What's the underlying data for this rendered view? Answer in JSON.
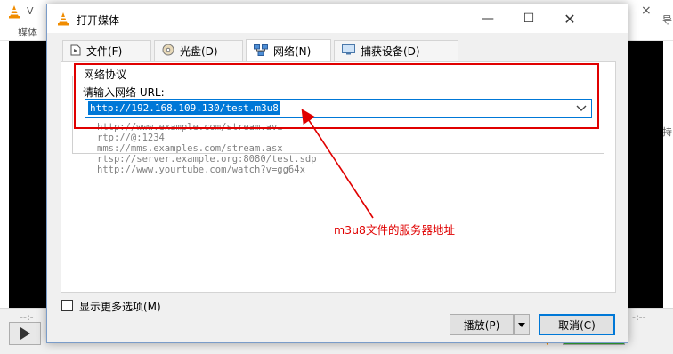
{
  "background": {
    "title_fragment": "V",
    "menu_fragment": "媒体",
    "close_glyph": "×",
    "right_fragments": [
      "导",
      "持"
    ],
    "time_left": "--:-",
    "time_right": "-:--"
  },
  "dialog": {
    "title": "打开媒体",
    "minimize_glyph": "—",
    "maximize_glyph": "☐",
    "close_glyph": "✕",
    "tabs": [
      {
        "label": "文件(F)",
        "icon": "file-icon"
      },
      {
        "label": "光盘(D)",
        "icon": "disc-icon"
      },
      {
        "label": "网络(N)",
        "icon": "network-icon"
      },
      {
        "label": "捕获设备(D)",
        "icon": "capture-device-icon"
      }
    ],
    "active_tab": 2,
    "group_title": "网络协议",
    "url_prompt": "请输入网络 URL:",
    "url_value": "http://192.168.109.130/test.m3u8",
    "examples": [
      "http://www.example.com/stream.avi",
      "rtp://@:1234",
      "mms://mms.examples.com/stream.asx",
      "rtsp://server.example.org:8080/test.sdp",
      "http://www.yourtube.com/watch?v=gg64x"
    ],
    "more_options_label": "显示更多选项(M)",
    "play_label": "播放(P)",
    "cancel_label": "取消(C)"
  },
  "annotation": {
    "text": "m3u8文件的服务器地址",
    "color": "#e00000"
  },
  "colors": {
    "accent": "#0078d7",
    "vlc_orange": "#f08c00"
  }
}
